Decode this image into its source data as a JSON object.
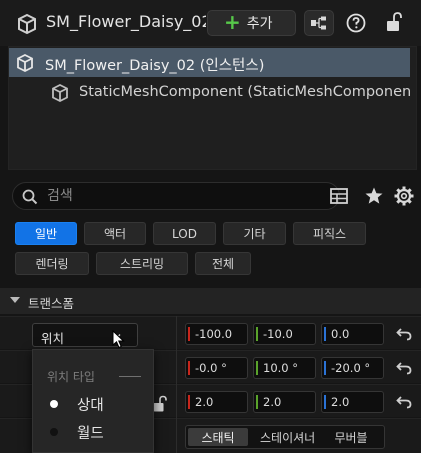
{
  "header": {
    "actor_name": "SM_Flower_Daisy_02",
    "add_label": "추가",
    "icons": [
      "static-mesh-actor-icon",
      "plus-icon",
      "blueprint-icon",
      "help-icon",
      "lock-icon"
    ]
  },
  "tree": {
    "items": [
      {
        "label": "SM_Flower_Daisy_02 (인스턴스)",
        "selected": true
      },
      {
        "label": "StaticMeshComponent (StaticMeshComponent)",
        "selected": false
      }
    ]
  },
  "search": {
    "placeholder": "검색"
  },
  "filter_tabs": [
    {
      "label": "일반",
      "active": true
    },
    {
      "label": "액터"
    },
    {
      "label": "LOD"
    },
    {
      "label": "기타"
    },
    {
      "label": "피직스"
    },
    {
      "label": "렌더링"
    },
    {
      "label": "스트리밍"
    },
    {
      "label": "전체"
    }
  ],
  "transform": {
    "section_title": "트랜스폼",
    "location_label": "위치",
    "location": {
      "x": "-100.0",
      "y": "-10.0",
      "z": "0.0"
    },
    "rotation": {
      "x": "-0.0 °",
      "y": "10.0 °",
      "z": "-20.0 °"
    },
    "scale": {
      "x": "2.0",
      "y": "2.0",
      "z": "2.0"
    },
    "mobility_options": [
      {
        "label": "스태틱",
        "active": true
      },
      {
        "label": "스테이셔너리"
      },
      {
        "label": "무버블"
      }
    ]
  },
  "location_popup": {
    "header": "위치 타입",
    "options": [
      {
        "label": "상대",
        "color": "#ffffff"
      },
      {
        "label": "월드",
        "color": "#111111"
      }
    ]
  },
  "colors": {
    "accent": "#1273e6",
    "axis_x": "#c8261c",
    "axis_y": "#5aa32b",
    "axis_z": "#2b73d6",
    "selected_row": "#4a5968"
  }
}
